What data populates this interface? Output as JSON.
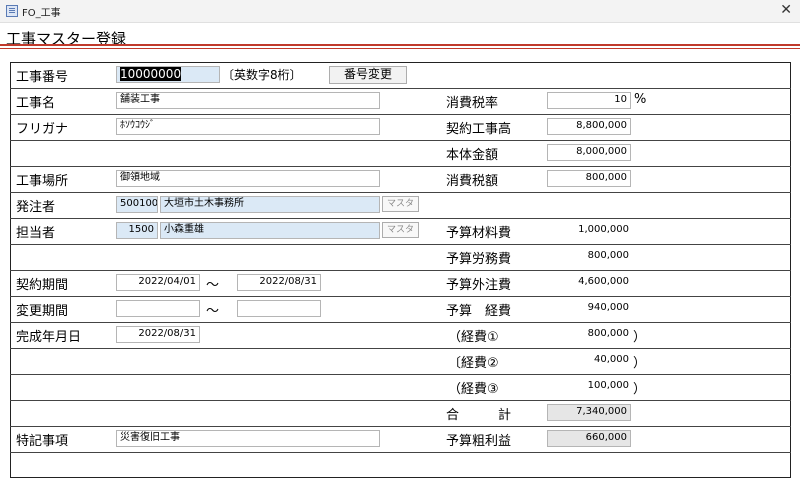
{
  "window": {
    "title": "FO_工事",
    "close": "✕"
  },
  "form": {
    "title": "工事マスター登録"
  },
  "left": {
    "construction_no": {
      "label": "工事番号",
      "value": "10000000",
      "hint": "〔英数字8桁〕",
      "button": "番号変更"
    },
    "name": {
      "label": "工事名",
      "value": "舗装工事"
    },
    "furigana": {
      "label": "フリガナ",
      "value": "ﾎｿｳｺｳｼﾞ"
    },
    "place": {
      "label": "工事場所",
      "value": "御領地域"
    },
    "client": {
      "label": "発注者",
      "code": "500100",
      "name": "大垣市土木事務所",
      "button": "マスタ"
    },
    "staff": {
      "label": "担当者",
      "code": "1500",
      "name": "小森重雄",
      "button": "マスタ"
    },
    "contract_period": {
      "label": "契約期間",
      "from": "2022/04/01",
      "tilde": "～",
      "to": "2022/08/31"
    },
    "change_period": {
      "label": "変更期間",
      "from": "",
      "tilde": "～",
      "to": ""
    },
    "completion": {
      "label": "完成年月日",
      "value": "2022/08/31"
    },
    "notes": {
      "label": "特記事項",
      "value": "災害復旧工事"
    }
  },
  "right": {
    "tax_rate": {
      "label": "消費税率",
      "value": "10",
      "unit": "%"
    },
    "contract_amount": {
      "label": "契約工事高",
      "value": "8,800,000"
    },
    "base_amount": {
      "label": "本体金額",
      "value": "8,000,000"
    },
    "tax_amount": {
      "label": "消費税額",
      "value": "800,000"
    },
    "material": {
      "label": "予算材料費",
      "value": "1,000,000"
    },
    "labor": {
      "label": "予算労務費",
      "value": "800,000"
    },
    "outsourcing": {
      "label": "予算外注費",
      "value": "4,600,000"
    },
    "expenses": {
      "label": "予算　経費",
      "value": "940,000"
    },
    "exp1": {
      "label": "（経費①",
      "value": "800,000",
      "close": "）"
    },
    "exp2": {
      "label": "〔経費②",
      "value": "40,000",
      "close": "）"
    },
    "exp3": {
      "label": "（経費③",
      "value": "100,000",
      "close": "）"
    },
    "total": {
      "label": "合　　　計",
      "value": "7,340,000"
    },
    "gross_profit": {
      "label": "予算粗利益",
      "value": "660,000"
    }
  }
}
